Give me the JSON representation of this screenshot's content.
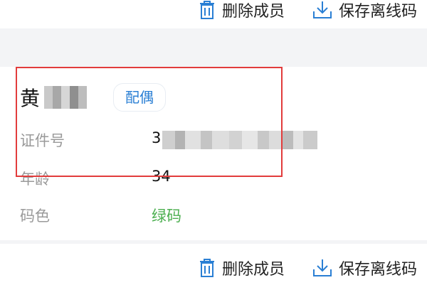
{
  "actions": {
    "delete_label": "删除成员",
    "save_offline_label": "保存离线码"
  },
  "member": {
    "name_visible": "黄",
    "relation_tag": "配偶",
    "fields": [
      {
        "label": "证件号",
        "value": "3"
      },
      {
        "label": "年龄",
        "value": "34"
      },
      {
        "label": "码色",
        "value": "绿码"
      }
    ]
  },
  "colors": {
    "accent": "#2a7fd4",
    "green_code": "#4caf50",
    "highlight": "#e23c3c",
    "separator": "#f3f4f6"
  },
  "icons": {
    "delete": "trash-icon",
    "save": "download-icon"
  }
}
